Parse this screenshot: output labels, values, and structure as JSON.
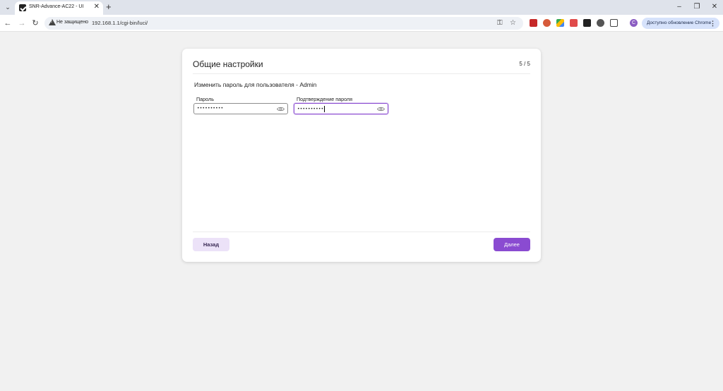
{
  "browser": {
    "tab_title": "SNR-Advance-AC22 - UI",
    "security_label": "Не защищено",
    "url": "192.168.1.1/cgi-bin/luci/",
    "update_label": "Доступно обновление Chrome",
    "profile_initial": "C"
  },
  "card": {
    "title": "Общие настройки",
    "step": "5 / 5",
    "section_label": "Изменить пароль для пользователя - Admin",
    "password": {
      "label": "Пароль",
      "value": "••••••••••"
    },
    "confirm": {
      "label": "Подтверждение пароля",
      "value": "••••••••••"
    },
    "back_label": "Назад",
    "next_label": "Далее"
  },
  "colors": {
    "accent": "#8a4bd1",
    "back_button_bg": "#ece2f8",
    "page_bg": "#f1f1f1"
  }
}
